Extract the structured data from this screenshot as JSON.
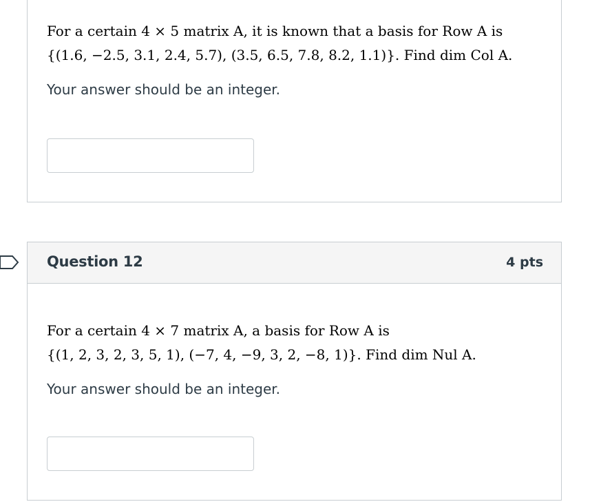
{
  "questions": [
    {
      "line1": "For a certain 4 × 5 matrix A, it is known that a basis for Row A is",
      "line2": "{(1.6, −2.5, 3.1, 2.4, 5.7), (3.5, 6.5, 7.8, 8.2, 1.1)}.  Find dim Col A.",
      "hint": "Your answer should be an integer.",
      "answer_value": ""
    },
    {
      "title": "Question 12",
      "points": "4 pts",
      "line1": "For a certain 4 × 7 matrix A, a basis for Row A is",
      "line2": "{(1, 2, 3, 2, 3, 5, 1), (−7, 4, −9, 3, 2, −8, 1)}. Find dim Nul A.",
      "hint": "Your answer should be an integer.",
      "answer_value": ""
    }
  ],
  "icons": {
    "flag": "flag-question-icon"
  }
}
